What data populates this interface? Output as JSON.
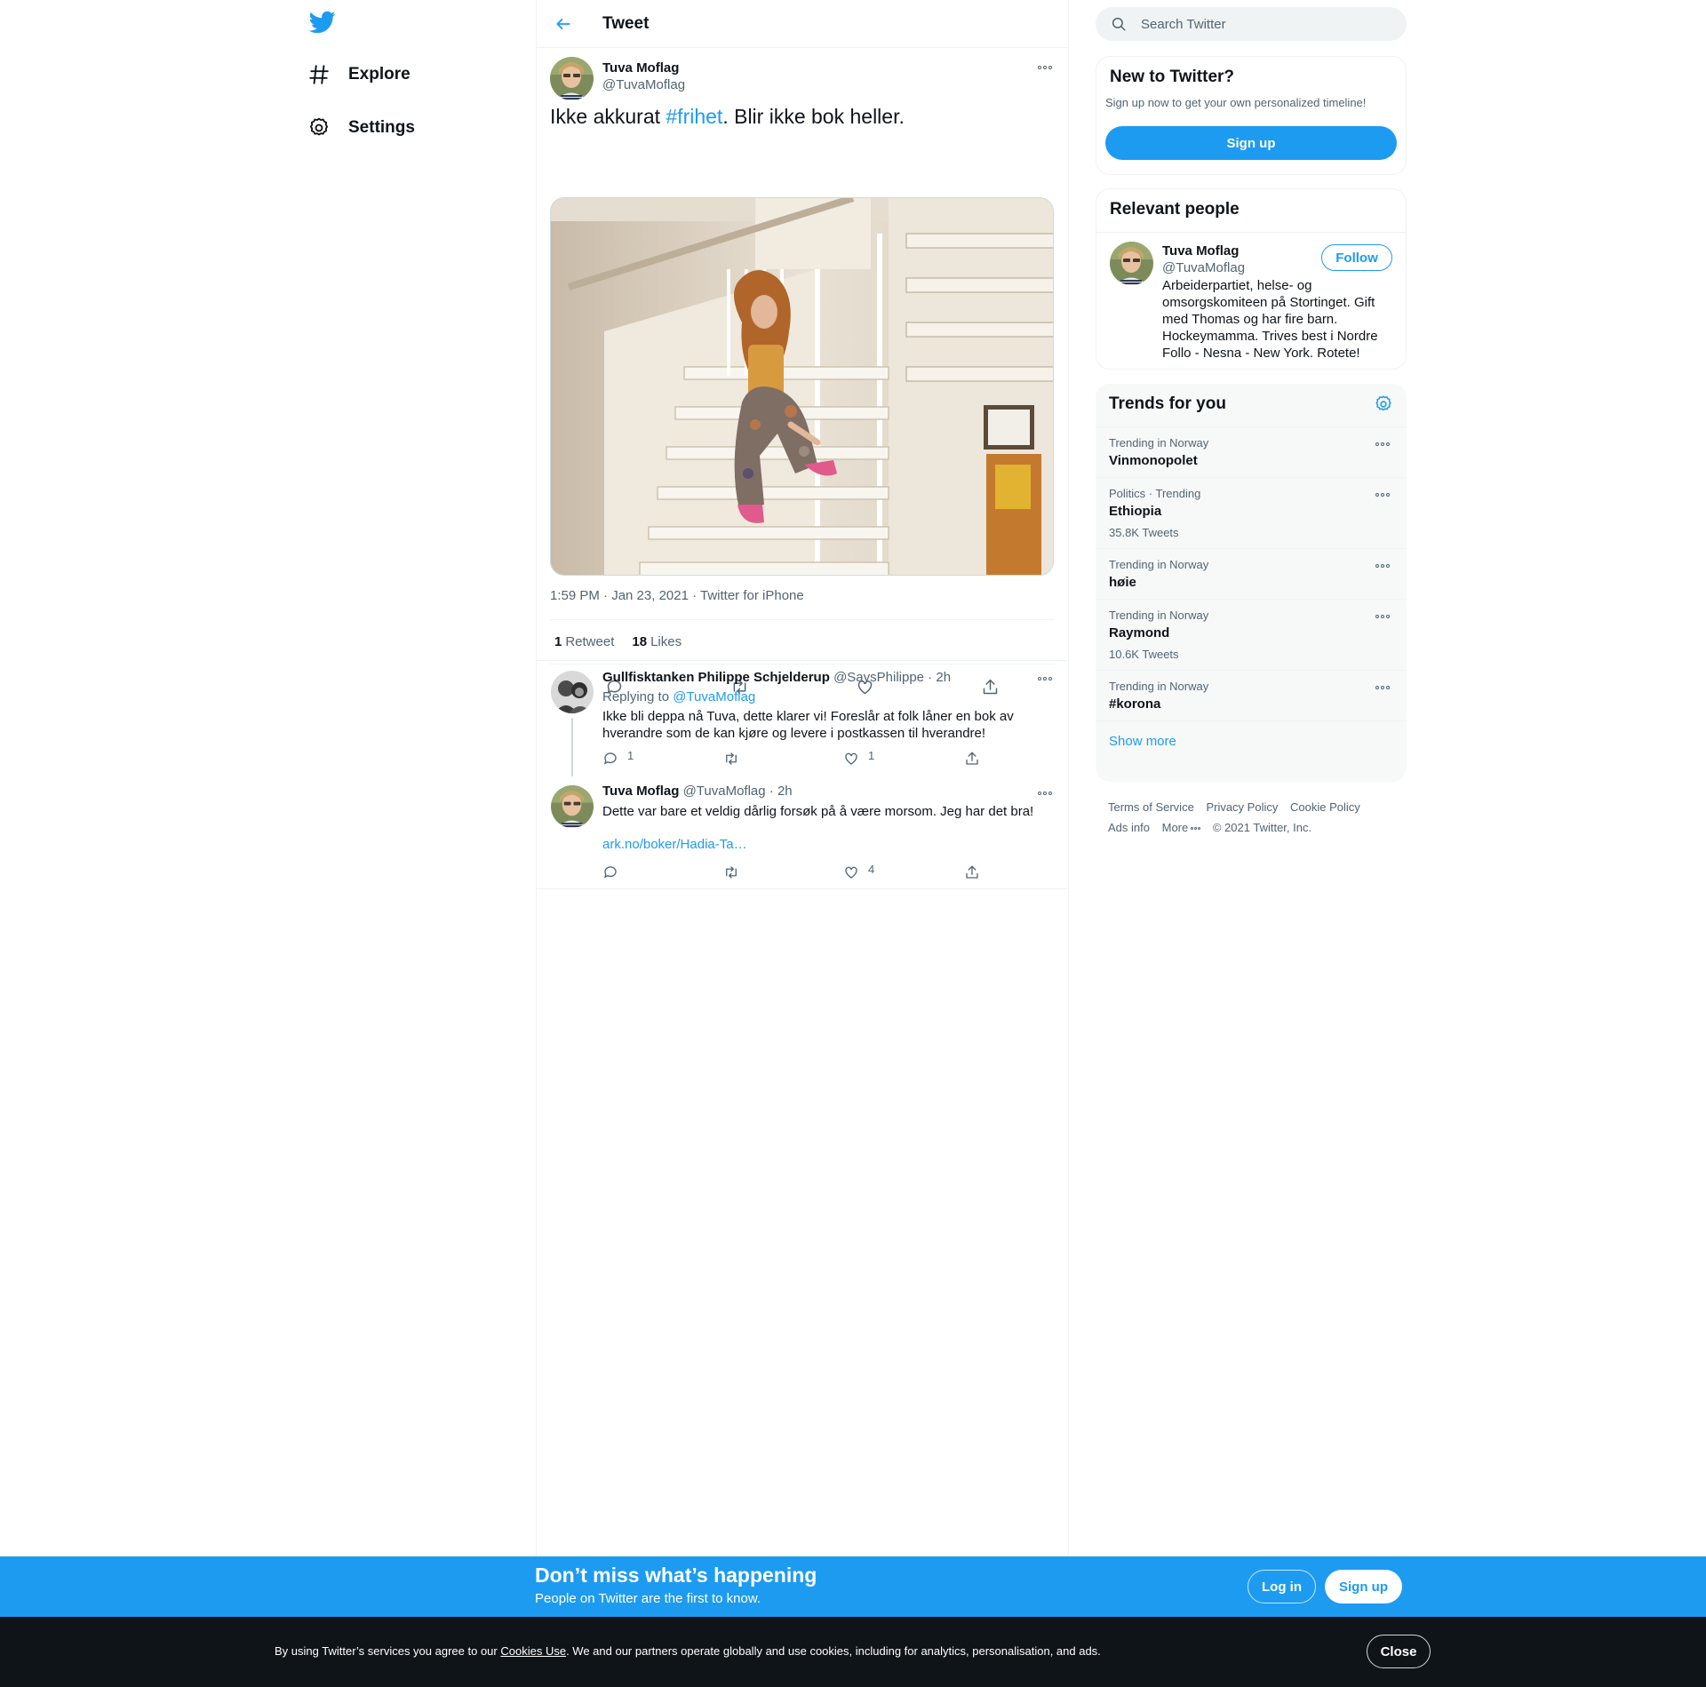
{
  "colors": {
    "accent": "#1d9bf0",
    "text": "#0f1419",
    "secondary_text": "#536471",
    "border": "#eff3f4",
    "cookie_bar_bg": "#0f1419"
  },
  "nav": {
    "logo_icon": "twitter-bird-icon",
    "items": [
      {
        "label": "Explore",
        "icon": "hashtag-icon"
      },
      {
        "label": "Settings",
        "icon": "gear-icon"
      }
    ]
  },
  "header": {
    "back_icon": "arrow-left-icon",
    "title": "Tweet"
  },
  "tweet": {
    "author_name": "Tuva Moflag",
    "author_handle": "@TuvaMoflag",
    "text_before": "Ikke akkurat ",
    "hashtag": "#frihet",
    "text_after": ". Blir ikke bok heller.",
    "timestamp": "1:59 PM · Jan 23, 2021",
    "meta_separator": " · ",
    "source": "Twitter for iPhone",
    "retweet_count": "1",
    "retweet_label": "Retweet",
    "like_count": "18",
    "like_label": "Likes",
    "actions": [
      "reply-icon",
      "retweet-icon",
      "like-icon",
      "share-icon"
    ]
  },
  "replies": [
    {
      "name": "Gullfisktanken Philippe Schjelderup",
      "handle": "@SaysPhilippe",
      "dot": " · ",
      "time": "2h",
      "replying_prefix": "Replying to ",
      "replying_to": "@TuvaMoflag",
      "text": "Ikke bli deppa nå Tuva, dette klarer vi!  Foreslår at folk låner en bok av hverandre som de kan kjøre og levere i postkassen til hverandre!",
      "reply_count": "1",
      "retweet_count": "",
      "like_count": "1"
    },
    {
      "name": "Tuva Moflag",
      "handle": "@TuvaMoflag",
      "dot": " · ",
      "time": "2h",
      "text": "Dette var bare et veldig dårlig forsøk på å være morsom. Jeg har det bra!",
      "link": "ark.no/boker/Hadia-Ta…",
      "reply_count": "",
      "retweet_count": "",
      "like_count": "4"
    }
  ],
  "search": {
    "placeholder": "Search Twitter",
    "icon": "search-icon"
  },
  "new_to_twitter": {
    "title": "New to Twitter?",
    "subtitle": "Sign up now to get your own personalized timeline!",
    "signup_label": "Sign up"
  },
  "relevant_people": {
    "title": "Relevant people",
    "person": {
      "name": "Tuva Moflag",
      "handle": "@TuvaMoflag",
      "bio": "Arbeiderpartiet, helse- og omsorgskomiteen på Stortinget. Gift med Thomas og har fire barn. Hockeymamma. Trives best i Nordre Follo - Nesna - New York. Rotete!",
      "follow_label": "Follow"
    }
  },
  "trends": {
    "title": "Trends for you",
    "settings_icon": "gear-icon",
    "items": [
      {
        "context": "Trending in Norway",
        "name": "Vinmonopolet",
        "count": ""
      },
      {
        "context": "Politics · Trending",
        "name": "Ethiopia",
        "count": "35.8K Tweets"
      },
      {
        "context": "Trending in Norway",
        "name": "høie",
        "count": ""
      },
      {
        "context": "Trending in Norway",
        "name": "Raymond",
        "count": "10.6K Tweets"
      },
      {
        "context": "Trending in Norway",
        "name": "#korona",
        "count": ""
      }
    ],
    "show_more": "Show more"
  },
  "footer": {
    "links": [
      "Terms of Service",
      "Privacy Policy",
      "Cookie Policy",
      "Ads info",
      "More"
    ],
    "copyright": "© 2021 Twitter, Inc."
  },
  "banner": {
    "title": "Don’t miss what’s happening",
    "subtitle": "People on Twitter are the first to know.",
    "login_label": "Log in",
    "signup_label": "Sign up"
  },
  "cookie_bar": {
    "text_before": "By using Twitter’s services you agree to our ",
    "link": "Cookies Use",
    "text_after": ". We and our partners operate globally and use cookies, including for analytics, personalisation, and ads.",
    "close_label": "Close"
  }
}
